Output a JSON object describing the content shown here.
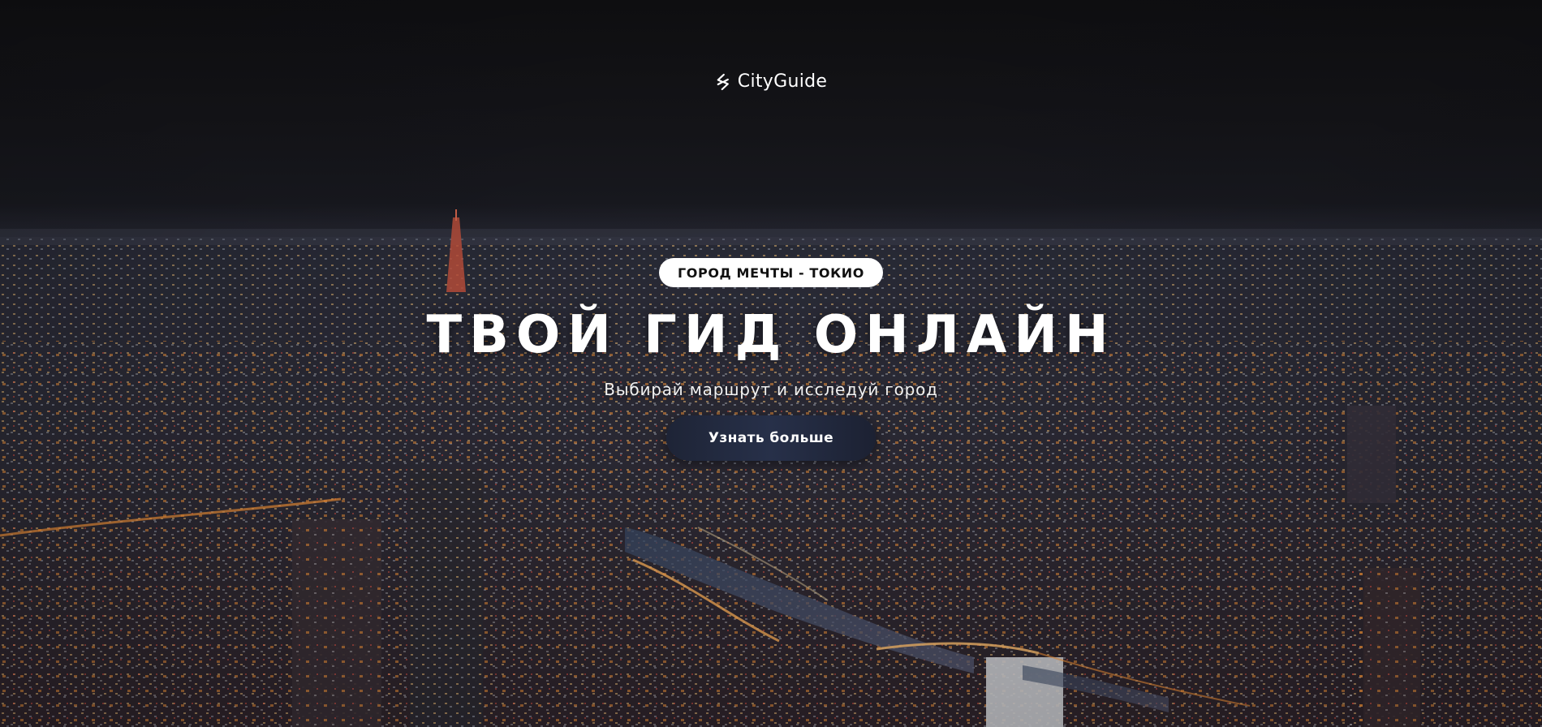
{
  "brand": {
    "name": "CityGuide",
    "icon": "cityguide-logo-icon"
  },
  "hero": {
    "badge": "ГОРОД МЕЧТЫ - ТОКИО",
    "headline": "ТВОЙ ГИД ОНЛАЙН",
    "subtitle": "Выбирай маршрут и исследуй город",
    "cta_label": "Узнать больше",
    "background": "tokyo-night-skyline-photo"
  },
  "colors": {
    "sky": "#121216",
    "badge_bg": "#ffffff",
    "cta_bg": "#232a3f",
    "text": "#ffffff"
  }
}
